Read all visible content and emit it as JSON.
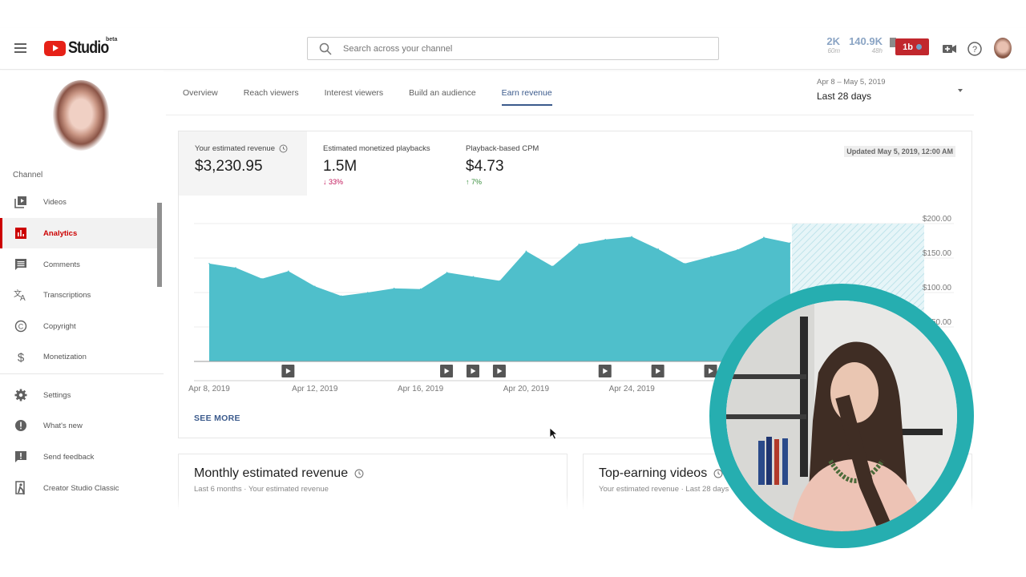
{
  "header": {
    "app_name": "Studio",
    "beta_label": "beta",
    "search_placeholder": "Search across your channel",
    "stats": [
      {
        "value": "2K",
        "sub": "60m"
      },
      {
        "value": "140.9K",
        "sub": "48h"
      }
    ],
    "extension_badge": "1b"
  },
  "sidebar": {
    "section_label": "Channel",
    "items": [
      {
        "label": "Videos",
        "icon": "videos-icon"
      },
      {
        "label": "Analytics",
        "icon": "analytics-icon",
        "active": true
      },
      {
        "label": "Comments",
        "icon": "comments-icon"
      },
      {
        "label": "Transcriptions",
        "icon": "transcriptions-icon"
      },
      {
        "label": "Copyright",
        "icon": "copyright-icon"
      },
      {
        "label": "Monetization",
        "icon": "monetization-icon"
      }
    ],
    "footer_items": [
      {
        "label": "Settings",
        "icon": "settings-icon"
      },
      {
        "label": "What's new",
        "icon": "whats-new-icon"
      },
      {
        "label": "Send feedback",
        "icon": "feedback-icon"
      },
      {
        "label": "Creator Studio Classic",
        "icon": "classic-icon"
      }
    ]
  },
  "tabs": [
    {
      "label": "Overview"
    },
    {
      "label": "Reach viewers"
    },
    {
      "label": "Interest viewers"
    },
    {
      "label": "Build an audience"
    },
    {
      "label": "Earn revenue",
      "active": true
    }
  ],
  "date_range": {
    "range": "Apr 8 – May 5, 2019",
    "label": "Last 28 days"
  },
  "metrics": [
    {
      "label": "Your estimated revenue",
      "value": "$3,230.95",
      "change": ""
    },
    {
      "label": "Estimated monetized playbacks",
      "value": "1.5M",
      "change": "33%",
      "direction": "down"
    },
    {
      "label": "Playback-based CPM",
      "value": "$4.73",
      "change": "7%",
      "direction": "up"
    }
  ],
  "updated_text": "Updated May 5, 2019, 12:00 AM",
  "see_more": "SEE MORE",
  "colors": {
    "area": "#4fbfcb",
    "accent": "#3b5a8c",
    "brand_red": "#e62117",
    "webcam_ring": "#26aeb0"
  },
  "chart_data": {
    "type": "area",
    "title": "Your estimated revenue",
    "xlabel": "",
    "ylabel": "",
    "x": [
      "Apr 8",
      "Apr 9",
      "Apr 10",
      "Apr 11",
      "Apr 12",
      "Apr 13",
      "Apr 14",
      "Apr 15",
      "Apr 16",
      "Apr 17",
      "Apr 18",
      "Apr 19",
      "Apr 20",
      "Apr 21",
      "Apr 22",
      "Apr 23",
      "Apr 24",
      "Apr 25",
      "Apr 26",
      "Apr 27",
      "Apr 28",
      "Apr 29",
      "Apr 30"
    ],
    "values": [
      142,
      136,
      120,
      131,
      109,
      95,
      100,
      106,
      105,
      129,
      123,
      117,
      160,
      138,
      170,
      177,
      181,
      163,
      142,
      152,
      162,
      180,
      172
    ],
    "x_tick_labels": [
      "Apr 8, 2019",
      "Apr 12, 2019",
      "Apr 16, 2019",
      "Apr 20, 2019",
      "Apr 24, 2019"
    ],
    "x_tick_indices": [
      0,
      4,
      8,
      12,
      16
    ],
    "y_tick_labels": [
      "$200.00",
      "$150.00",
      "$100.00",
      "$50.00"
    ],
    "y_ticks": [
      200,
      150,
      100,
      50
    ],
    "ylim": [
      0,
      200
    ],
    "pending_days": 5,
    "video_marker_indices": [
      3,
      9,
      10,
      11,
      15,
      17,
      19
    ],
    "grid": true,
    "y_axis_side": "right"
  },
  "bottom_cards": [
    {
      "title": "Monthly estimated revenue",
      "subtitle": "Last 6 months · Your estimated revenue"
    },
    {
      "title": "Top-earning videos",
      "subtitle": "Your estimated revenue · Last 28 days"
    }
  ]
}
